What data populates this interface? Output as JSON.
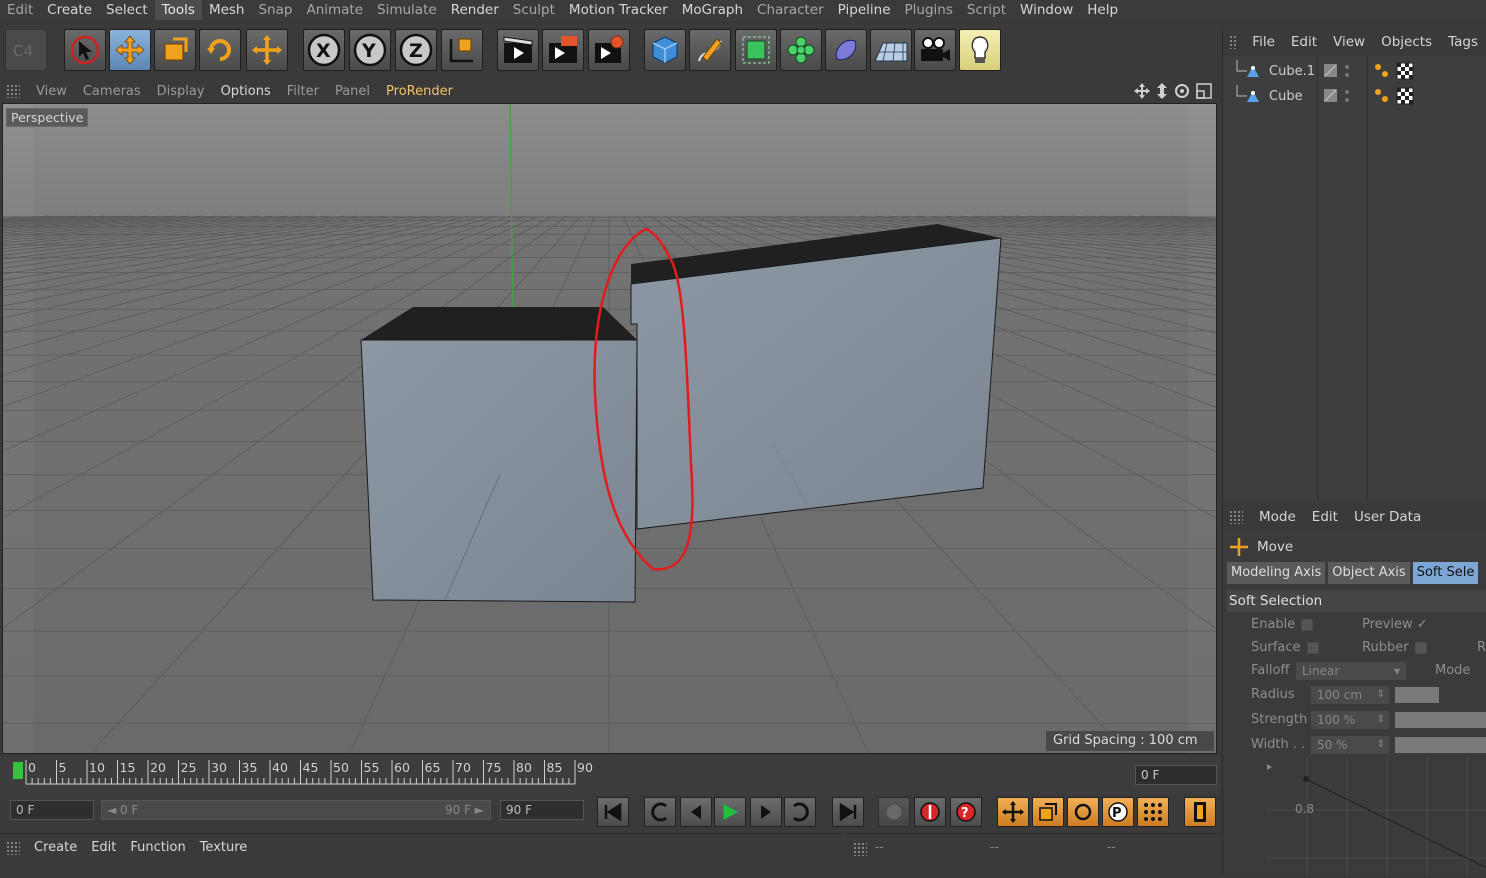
{
  "menubar": {
    "items": [
      {
        "label": "Edit",
        "style": "dim"
      },
      {
        "label": "Create",
        "style": "normal"
      },
      {
        "label": "Select",
        "style": "normal"
      },
      {
        "label": "Tools",
        "style": "active"
      },
      {
        "label": "Mesh",
        "style": "normal"
      },
      {
        "label": "Snap",
        "style": "dim"
      },
      {
        "label": "Animate",
        "style": "dim"
      },
      {
        "label": "Simulate",
        "style": "dim"
      },
      {
        "label": "Render",
        "style": "normal"
      },
      {
        "label": "Sculpt",
        "style": "dim"
      },
      {
        "label": "Motion Tracker",
        "style": "normal"
      },
      {
        "label": "MoGraph",
        "style": "normal"
      },
      {
        "label": "Character",
        "style": "dim"
      },
      {
        "label": "Pipeline",
        "style": "normal"
      },
      {
        "label": "Plugins",
        "style": "dim"
      },
      {
        "label": "Script",
        "style": "dim"
      },
      {
        "label": "Window",
        "style": "normal"
      },
      {
        "label": "Help",
        "style": "normal"
      }
    ]
  },
  "toolbar": {
    "icons": [
      "undo-icon",
      "live-selection-icon",
      "move-tool-icon",
      "scale-tool-icon",
      "rotate-tool-icon",
      "recent-tool-icon",
      "x-axis-lock-icon",
      "y-axis-lock-icon",
      "z-axis-lock-icon",
      "world-coordinate-icon",
      "render-view-icon",
      "render-picture-viewer-icon",
      "render-settings-icon",
      "cube-primitive-icon",
      "pen-spline-icon",
      "subdivision-surface-icon",
      "cloner-icon",
      "deformer-icon",
      "floor-icon",
      "camera-icon",
      "light-icon"
    ]
  },
  "viewport_menu": {
    "items": [
      {
        "label": "View",
        "style": "dim"
      },
      {
        "label": "Cameras",
        "style": "dim"
      },
      {
        "label": "Display",
        "style": "dim"
      },
      {
        "label": "Options",
        "style": "on"
      },
      {
        "label": "Filter",
        "style": "dim"
      },
      {
        "label": "Panel",
        "style": "dim"
      },
      {
        "label": "ProRender",
        "style": "pro"
      }
    ]
  },
  "viewport": {
    "camera_label": "Perspective",
    "grid_spacing": "Grid Spacing : 100 cm",
    "annotation_color": "#e21c1c"
  },
  "timeline": {
    "ticks": [
      "0",
      "5",
      "10",
      "15",
      "20",
      "25",
      "30",
      "35",
      "40",
      "45",
      "50",
      "55",
      "60",
      "65",
      "70",
      "75",
      "80",
      "85",
      "90"
    ],
    "current_frame": "0 F",
    "playhead_color": "#33c23b"
  },
  "transport": {
    "start_field": "0 F",
    "range_start": "◄ 0 F",
    "range_end": "90 F ►",
    "end_field": "90 F"
  },
  "material_menu": {
    "items": [
      "Create",
      "Edit",
      "Function",
      "Texture"
    ]
  },
  "coord_panel": {
    "labels": [
      "--",
      "--",
      "--"
    ]
  },
  "object_manager": {
    "menu": [
      "File",
      "Edit",
      "View",
      "Objects",
      "Tags"
    ],
    "objects": [
      {
        "name": "Cube.1"
      },
      {
        "name": "Cube"
      }
    ]
  },
  "attributes": {
    "menu": [
      "Mode",
      "Edit",
      "User Data"
    ],
    "tool_name": "Move",
    "tabs": [
      {
        "label": "Modeling Axis",
        "selected": false
      },
      {
        "label": "Object Axis",
        "selected": false
      },
      {
        "label": "Soft Sele",
        "selected": true
      }
    ],
    "section": "Soft Selection",
    "enable_label": "Enable",
    "preview_label": "Preview",
    "preview_check": "✓",
    "surface_label": "Surface",
    "rubber_label": "Rubber",
    "r_label": "R",
    "falloff_label": "Falloff",
    "falloff_value": "Linear",
    "mode_label": "Mode",
    "radius_label": "Radius",
    "radius_value": "100 cm",
    "strength_label": "Strength",
    "strength_value": "100 %",
    "width_label": "Width . .",
    "width_value": "50 %",
    "graph_label": "0.8"
  }
}
